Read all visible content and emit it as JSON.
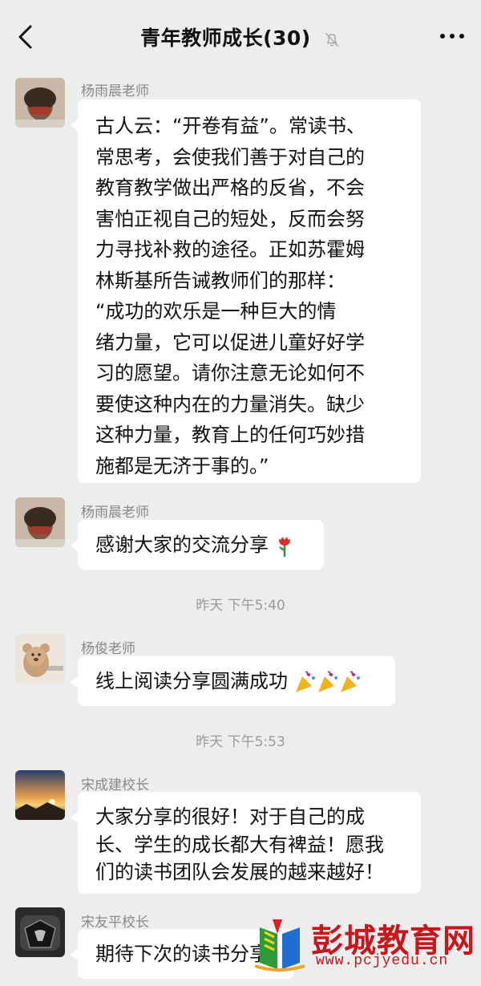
{
  "header": {
    "title": "青年教师成长(30)",
    "back_icon": "chevron-left-icon",
    "mute_icon": "bell-muted-icon",
    "more_icon": "more-dots-icon"
  },
  "messages": [
    {
      "sender": "杨雨晨老师",
      "lines": [
        "古人云：“开卷有益”。常读书、",
        "常思考，会使我们善于对自己的",
        "教育教学做出严格的反省，不会",
        "害怕正视自己的短处，反而会努",
        "力寻找补救的途径。正如苏霍姆",
        "林斯基所告诫教师们的那样：",
        "“成功的欢乐是一种巨大的情",
        "绪力量，它可以促进儿童好好学",
        "习的愿望。请你注意无论如何不",
        "要使这种内在的力量消失。缺少",
        "这种力量，教育上的任何巧妙措",
        "施都是无济于事的。”"
      ]
    },
    {
      "sender": "杨雨晨老师",
      "text": "感谢大家的交流分享",
      "emoji": "rose-emoji"
    },
    {
      "sender": "杨俊老师",
      "text": "线上阅读分享圆满成功",
      "emoji": "party-popper-emoji"
    },
    {
      "sender": "宋成建校长",
      "lines": [
        "大家分享的很好！对于自己的成",
        "长、学生的成长都大有裨益！愿我",
        "们的读书团队会发展的越来越好！"
      ]
    },
    {
      "sender": "宋友平校长",
      "text": "期待下次的读书分享"
    }
  ],
  "timestamps": [
    "昨天 下午5:40",
    "昨天 下午5:53"
  ],
  "watermark": {
    "name": "彭城教育网",
    "url": "www.pcjyedu.cn"
  },
  "colors": {
    "background": "#ededed",
    "bubble": "#ffffff",
    "sender": "#888888",
    "timestamp": "#999999",
    "watermark": "#c8161d"
  }
}
